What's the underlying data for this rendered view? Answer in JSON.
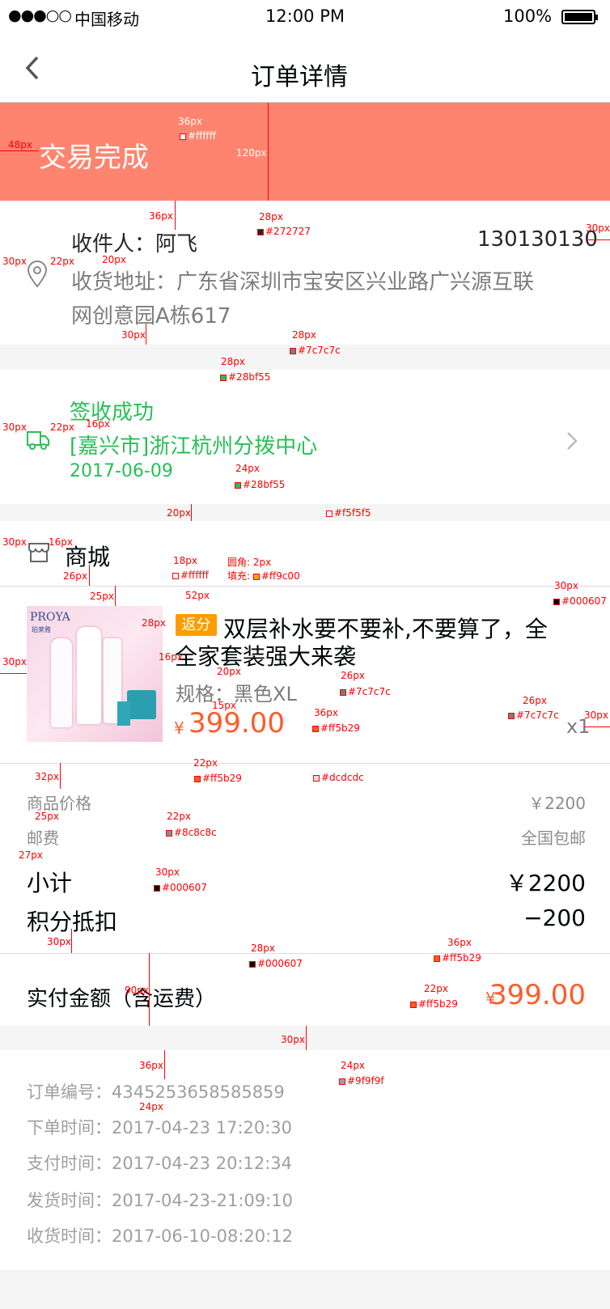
{
  "status_bar": {
    "signal": "●●●○○",
    "carrier": "中国移动",
    "time": "12:00 PM",
    "battery": "100%"
  },
  "nav": {
    "title": "订单详情"
  },
  "banner": {
    "status": "交易完成",
    "color": "#ff8470"
  },
  "receiver": {
    "name": "收件人：阿飞",
    "phone": "130130130",
    "address_line1": "收货地址：广东省深圳市宝安区兴业路广兴源互联",
    "address_line2": "网创意园A栋617"
  },
  "logistics": {
    "status": "签收成功",
    "location": "[嘉兴市]浙江杭州分拨中心",
    "date": "2017-06-09",
    "color": "#28bf55"
  },
  "shop": {
    "name": "商城"
  },
  "product": {
    "badge": "返分",
    "title_line1": "双层补水要不要补,不要算了，全",
    "title_line2": "全家套装强大来袭",
    "spec": "规格：黑色XL",
    "currency": "¥",
    "price": "399.00",
    "quantity": "x1",
    "image_brand": "PROYA",
    "image_brand_cn": "珀莱雅"
  },
  "summary": [
    {
      "label": "商品价格",
      "value": "￥2200"
    },
    {
      "label": "邮费",
      "value": "全国包邮"
    },
    {
      "label": "小计",
      "value": "￥2200"
    },
    {
      "label": "积分抵扣",
      "value": "−200"
    }
  ],
  "total": {
    "label": "实付金额（含运费）",
    "currency": "¥",
    "value": "399.00"
  },
  "order_info": [
    {
      "label": "订单编号：",
      "value": "4345253658585859"
    },
    {
      "label": "下单时间：",
      "value": "2017-04-23 17:20:30"
    },
    {
      "label": "支付时间：",
      "value": "2017-04-23 20:12:34"
    },
    {
      "label": "发货时间：",
      "value": "2017-04-23-21:09:10"
    },
    {
      "label": "收货时间：",
      "value": "2017-06-10-08:20:12"
    }
  ],
  "annotations": [
    "36px",
    "#ffffff",
    "48px",
    "120px",
    "36px",
    "28px",
    "#272727",
    "30px",
    "30px",
    "22px",
    "20px",
    "30px",
    "28px",
    "#7c7c7c",
    "28px",
    "#28bf55",
    "16px",
    "30px",
    "22px",
    "24px",
    "#28bf55",
    "20px",
    "#f5f5f5",
    "30px",
    "16px",
    "26px",
    "18px",
    "#ffffff",
    "圆角:  2px",
    "填充:",
    "#ff9c00",
    "52px",
    "25px",
    "30px",
    "#000607",
    "28px",
    "30px",
    "16px",
    "20px",
    "26px",
    "#7c7c7c",
    "15px",
    "36px",
    "#ff5b29",
    "26px",
    "#7c7c7c",
    "30px",
    "22px",
    "#ff5b29",
    "#dcdcdc",
    "32px",
    "25px",
    "22px",
    "#8c8c8c",
    "27px",
    "30px",
    "#000607",
    "30px",
    "28px",
    "#000607",
    "90px",
    "36px",
    "#ff5b29",
    "22px",
    "#ff5b29",
    "30px",
    "36px",
    "24px",
    "#9f9f9f",
    "24px"
  ]
}
